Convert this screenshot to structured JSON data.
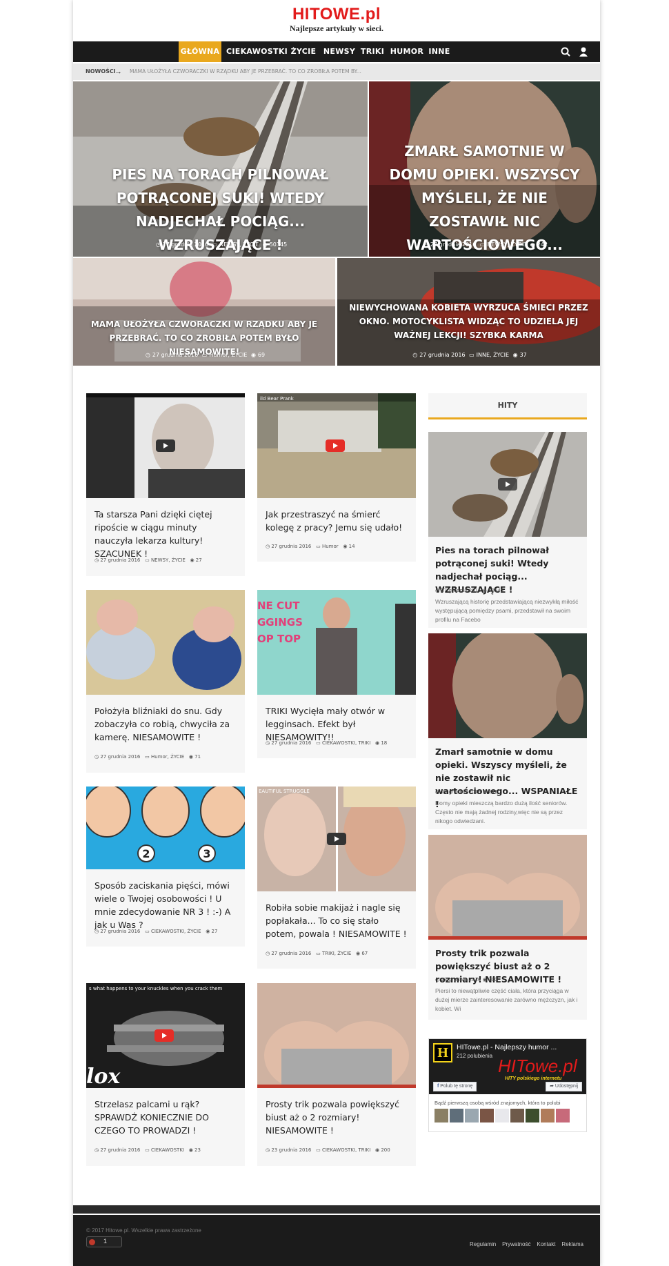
{
  "header": {
    "logo": "HITOWE.pl",
    "tagline": "Najlepsze artykuły w sieci."
  },
  "nav": {
    "items": [
      "GŁÓWNA",
      "CIEKAWOSTKI",
      "ŻYCIE",
      "NEWSY",
      "TRIKI",
      "HUMOR",
      "INNE"
    ],
    "accent": "#e9a81e"
  },
  "ticker": {
    "label": "NOWOŚCI",
    "arrow": "→",
    "text": "MAMA UŁOŻYŁA CZWORACZKI W RZĄDKU ABY JE PRZEBRAĆ. TO CO ZROBIŁA POTEM BY..."
  },
  "hero": [
    {
      "title": "PIES NA TORACH PILNOWAŁ POTRĄCONEJ SUKI! WTEDY NADJECHAŁ POCIĄG... WZRUSZAJĄCE !",
      "date": "27 grudnia 2016",
      "cats": "NEWSY, ŻYCIE",
      "views": "50345"
    },
    {
      "title": "ZMARŁ SAMOTNIE W DOMU OPIEKI. WSZYSCY MYŚLELI, ŻE NIE ZOSTAWIŁ NIC WARTOŚCIOWEGO... WSPANIAŁE !",
      "date": "27 grudnia 2016",
      "cats": "NEWSY, ŻYCIE",
      "views": "242"
    },
    {
      "title": "MAMA UŁOŻYŁA CZWORACZKI W RZĄDKU ABY JE PRZEBRAĆ. TO CO ZROBIŁA POTEM BYŁO NIESAMOWITE!",
      "date": "27 grudnia 2016",
      "cats": "Humor, ŻYCIE",
      "views": "69"
    },
    {
      "title": "NIEWYCHOWANA KOBIETA WYRZUCA ŚMIECI PRZEZ OKNO. MOTOCYKLISTA WIDZĄC TO UDZIELA JEJ WAŻNEJ LEKCJI! SZYBKA KARMA",
      "date": "27 grudnia 2016",
      "cats": "INNE, ŻYCIE",
      "views": "37"
    }
  ],
  "cards": [
    {
      "title": "Ta starsza Pani dzięki ciętej ripoście w ciągu minuty nauczyła lekarza kultury! SZACUNEK !",
      "date": "27 grudnia 2016",
      "cats": "NEWSY, ŻYCIE",
      "views": "27"
    },
    {
      "title": "Jak przestraszyć na śmierć kolegę z pracy? Jemu się udało!",
      "date": "27 grudnia 2016",
      "cats": "Humor",
      "views": "14",
      "video_caption": "ild Bear Prank"
    },
    {
      "title": "Położyła bliźniaki do snu. Gdy zobaczyła co robią, chwyciła za kamerę. NIESAMOWITE !",
      "date": "27 grudnia 2016",
      "cats": "Humor, ŻYCIE",
      "views": "71"
    },
    {
      "title": "TRIKI Wycięła mały otwór w legginsach. Efekt był NIESAMOWITY!!",
      "date": "27 grudnia 2016",
      "cats": "CIEKAWOSTKI, TRIKI",
      "views": "18",
      "image_text": "NE CUT\nGGINGS\nOP TOP"
    },
    {
      "title": "Sposób zaciskania pięści, mówi wiele o Twojej osobowości ! U mnie zdecydowanie NR 3 ! :-) A jak u Was ?",
      "date": "27 grudnia 2016",
      "cats": "CIEKAWOSTKI, ŻYCIE",
      "views": "27",
      "numbers": [
        "2",
        "3"
      ]
    },
    {
      "title": "Robiła sobie makijaż i nagle się popłakała... To co się stało potem, powala ! NIESAMOWITE !",
      "date": "27 grudnia 2016",
      "cats": "TRIKI, ŻYCIE",
      "views": "67",
      "video_caption": "EAUTIFUL STRUGGLE"
    },
    {
      "title": "Strzelasz palcami u rąk? SPRAWDŹ KONIECZNIE DO CZEGO TO PROWADZI !",
      "date": "27 grudnia 2016",
      "cats": "CIEKAWOSTKI",
      "views": "23",
      "video_caption": "s what happens to your knuckles when you crack them",
      "watermark": "lox"
    },
    {
      "title": "Prosty trik pozwala powiększyć biust aż o 2 rozmiary! NIESAMOWITE !",
      "date": "23 grudnia 2016",
      "cats": "CIEKAWOSTKI, TRIKI",
      "views": "200"
    }
  ],
  "sidebar": {
    "heading": "HITY",
    "items": [
      {
        "title": "Pies na torach pilnował potrąconej suki! Wtedy nadjechał pociąg... WZRUSZAJĄCE !",
        "date": "27 grudnia 2016",
        "views": "50345",
        "excerpt": "Wzruszającą historię przedstawiającą niezwykłą miłość występującą pomiędzy psami, przedstawił na swoim profilu na Facebo"
      },
      {
        "title": "Zmarł samotnie w domu opieki. Wszyscy myśleli, że nie zostawił nic wartościowego... WSPANIAŁE !",
        "date": "27 grudnia 2016",
        "views": "242",
        "excerpt": "Domy opieki mieszczą bardzo dużą ilość seniorów. Często nie mają żadnej rodziny,więc nie są przez nikogo odwiedzani."
      },
      {
        "title": "Prosty trik pozwala powiększyć biust aż o 2 rozmiary! NIESAMOWITE !",
        "date": "23 grudnia 2016",
        "views": "200",
        "excerpt": "Piersi to niewątpliwie część ciała, która przyciąga w dużej mierze zainteresowanie zarówno mężczyzn, jak i kobiet. Wi"
      }
    ]
  },
  "facebook": {
    "page_name": "HITowe.pl - Najlepszy humor ...",
    "likes": "212 polubienia",
    "brand": "HITowe.pl",
    "brand_sub": "HITY polskiego internetu",
    "like_button": "Polub tę stronę",
    "share_button": "Udostępnij",
    "friends_text": "Bądź pierwszą osobą wśród znajomych, która to polubi"
  },
  "footer": {
    "copyright": "© 2017 Hitowe.pl. Wszelkie prawa zastrzeżone",
    "counter": "1",
    "links": [
      "Regulamin",
      "Prywatność",
      "Kontakt",
      "Reklama"
    ]
  }
}
